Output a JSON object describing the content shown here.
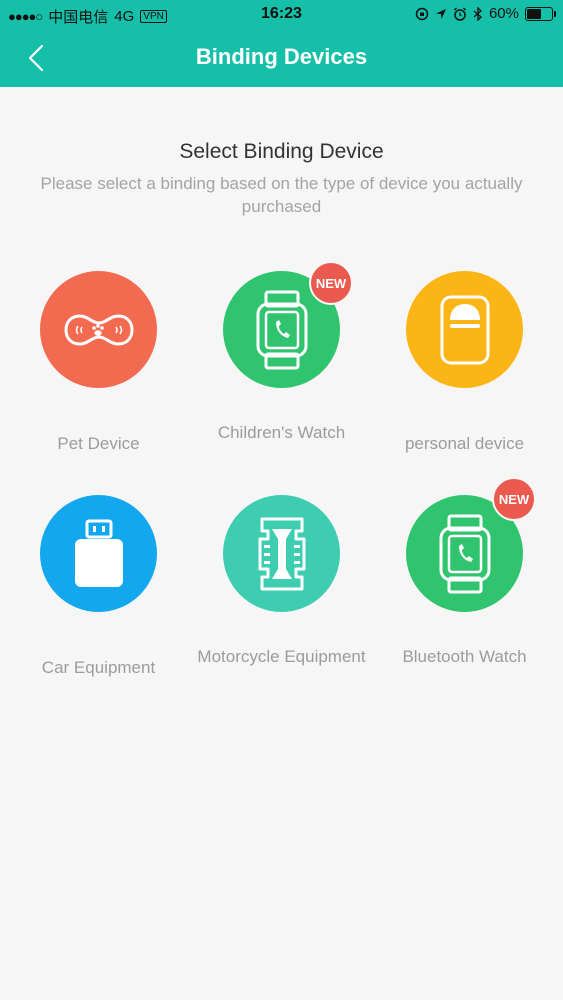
{
  "status_bar": {
    "carrier": "中国电信",
    "network": "4G",
    "vpn": "VPN",
    "time": "16:23",
    "battery": "60%",
    "battery_level": 0.6
  },
  "nav": {
    "title": "Binding Devices"
  },
  "main": {
    "heading": "Select Binding Device",
    "subtext": "Please select a binding based on the type of device you actually purchased"
  },
  "devices": [
    {
      "label": "Pet Device",
      "icon": "pet-tracker-icon",
      "color": "#f26b50",
      "badge": ""
    },
    {
      "label": "Children's Watch",
      "icon": "smartwatch-icon",
      "color": "#2fc46d",
      "badge": "NEW"
    },
    {
      "label": "personal device",
      "icon": "personal-tracker-icon",
      "color": "#fcb517",
      "badge": ""
    },
    {
      "label": "Car Equipment",
      "icon": "obd-device-icon",
      "color": "#13a7ee",
      "badge": ""
    },
    {
      "label": "Motorcycle Equipment",
      "icon": "motorcycle-tracker-icon",
      "color": "#3ecdb1",
      "badge": ""
    },
    {
      "label": "Bluetooth Watch",
      "icon": "smartwatch-icon",
      "color": "#2fc46d",
      "badge": "NEW"
    }
  ]
}
